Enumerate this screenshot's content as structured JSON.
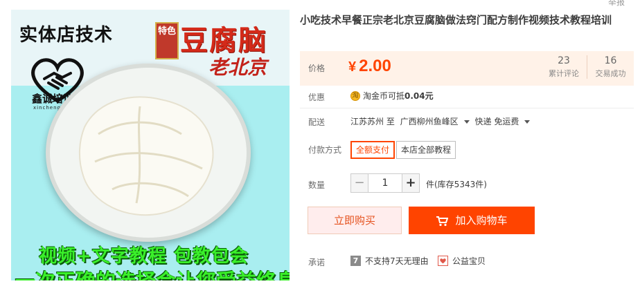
{
  "product_image": {
    "shop_text": "实体店技术",
    "badge": "特色",
    "title": "豆腐脑",
    "city": "老北京",
    "logo_name": "鑫诚培训",
    "logo_sub": "xinchengpeixun",
    "slogan1": "视频+文字教程  包教包会",
    "slogan2": "一次正确的选择会让您受益终身"
  },
  "top_cut_text": "举报",
  "title": "小吃技术早餐正宗老北京豆腐脑做法窍门配方制作视频技术教程培训",
  "price": {
    "label": "价格",
    "symbol": "¥",
    "value": "2.00",
    "reviews_count": "23",
    "reviews_label": "累计评论",
    "sales_count": "16",
    "sales_label": "交易成功"
  },
  "promo": {
    "label": "优惠",
    "icon_glyph": "淘",
    "text_prefix": "淘金币可抵",
    "amount": "0.04元"
  },
  "shipping": {
    "label": "配送",
    "origin": "江苏苏州 至",
    "destination": "广西柳州鱼峰区",
    "method": "快递 免运费"
  },
  "payment": {
    "label": "付款方式",
    "options": [
      "全额支付",
      "本店全部教程"
    ],
    "selected": "全额支付"
  },
  "quantity": {
    "label": "数量",
    "value": "1",
    "minus": "−",
    "plus": "+",
    "stock": "件(库存5343件)"
  },
  "buttons": {
    "buy_now": "立即购买",
    "add_to_cart": "加入购物车"
  },
  "promise": {
    "label": "承诺",
    "item1_icon": "7",
    "item1": "不支持7天无理由",
    "item2": "公益宝贝"
  },
  "colors": {
    "accent": "#ff4400",
    "price_bg": "#fff2e8",
    "buy_now_bg": "#ffeded"
  }
}
